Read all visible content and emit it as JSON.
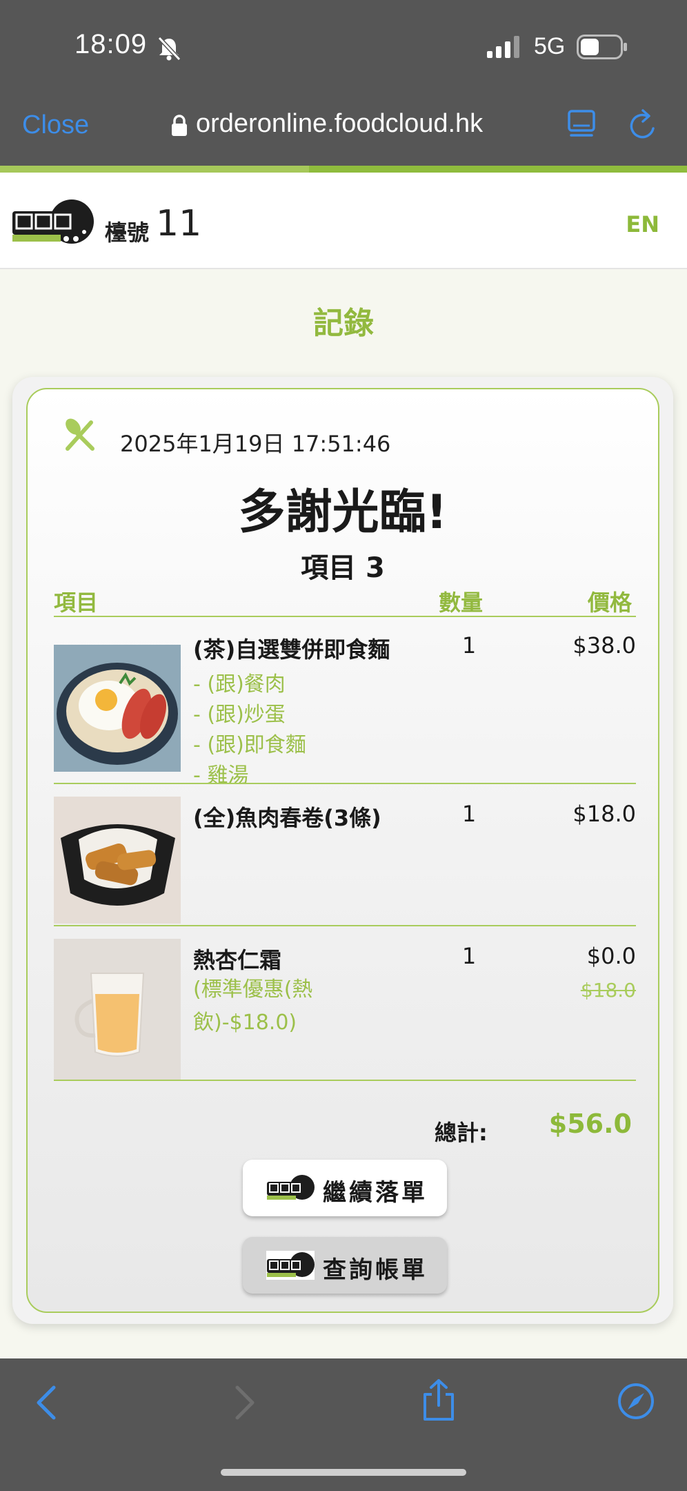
{
  "status_bar": {
    "time": "18:09",
    "network": "5G"
  },
  "browser": {
    "close_label": "Close",
    "url": "orderonline.foodcloud.hk",
    "page_load_progress": 0.45,
    "accent_color": "#3d8de8"
  },
  "header": {
    "table_label": "檯號",
    "table_number": "11",
    "language": "EN",
    "brand_color": "#8db93a"
  },
  "page": {
    "title": "記錄"
  },
  "order": {
    "timestamp": "2025年1月19日 17:51:46",
    "thanks": "多謝光臨!",
    "item_count_label": "項目 3",
    "columns": {
      "item": "項目",
      "qty": "數量",
      "price": "價格"
    },
    "items": [
      {
        "name": "(茶)自選雙併即食麵",
        "qty": "1",
        "price": "$38.0",
        "options": [
          "- (跟)餐肉",
          "- (跟)炒蛋",
          "- (跟)即食麵",
          "- 雞湯"
        ]
      },
      {
        "name": "(全)魚肉春卷(3條)",
        "qty": "1",
        "price": "$18.0"
      },
      {
        "name": "熱杏仁霜",
        "qty": "1",
        "price": "$0.0",
        "original_price": "$18.0",
        "discount": "(標準優惠(熱飲)-$18.0)"
      }
    ],
    "total_label": "總計:",
    "total_value": "$56.0"
  },
  "actions": {
    "continue_label": "繼續落單",
    "bill_label": "查詢帳單"
  }
}
